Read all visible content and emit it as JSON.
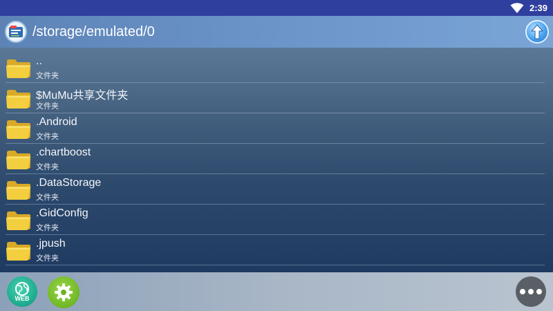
{
  "status_bar": {
    "time": "2:39",
    "wifi_icon": "wifi-icon"
  },
  "title_bar": {
    "app_icon": "file-manager-icon",
    "path": "/storage/emulated/0",
    "up_icon": "arrow-up-icon"
  },
  "files": [
    {
      "name": "..",
      "kind": "文件夹"
    },
    {
      "name": "$MuMu共享文件夹",
      "kind": "文件夹"
    },
    {
      "name": ".Android",
      "kind": "文件夹"
    },
    {
      "name": ".chartboost",
      "kind": "文件夹"
    },
    {
      "name": ".DataStorage",
      "kind": "文件夹"
    },
    {
      "name": ".GidConfig",
      "kind": "文件夹"
    },
    {
      "name": ".jpush",
      "kind": "文件夹"
    }
  ],
  "bottom_bar": {
    "web_label": "WEB",
    "web_icon": "globe-icon",
    "settings_icon": "gear-icon",
    "more_icon": "more-icon"
  },
  "colors": {
    "status_bar": "#2f3f9e",
    "folder_yellow": "#f3cf3f",
    "web_green": "#1ba88c",
    "settings_green": "#6cb522"
  }
}
